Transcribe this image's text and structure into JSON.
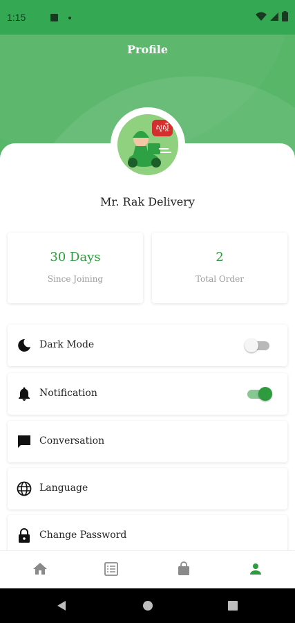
{
  "status_bar": {
    "time": "1:15"
  },
  "header": {
    "title": "Profile"
  },
  "profile": {
    "name": "Mr. Rak Delivery",
    "avatar_badge": "សូស្តី"
  },
  "stats": [
    {
      "value": "30 Days",
      "label": "Since Joining"
    },
    {
      "value": "2",
      "label": "Total Order"
    }
  ],
  "settings": [
    {
      "label": "Dark Mode",
      "icon": "moon-icon",
      "toggle": false
    },
    {
      "label": "Notification",
      "icon": "bell-icon",
      "toggle": true
    },
    {
      "label": "Conversation",
      "icon": "chat-icon"
    },
    {
      "label": "Language",
      "icon": "globe-icon"
    },
    {
      "label": "Change Password",
      "icon": "lock-icon"
    }
  ],
  "bottom_nav": [
    {
      "icon": "home-icon",
      "active": false
    },
    {
      "icon": "list-icon",
      "active": false
    },
    {
      "icon": "shopping-bag-icon",
      "active": false
    },
    {
      "icon": "person-icon",
      "active": true
    }
  ],
  "colors": {
    "primary": "#34a853",
    "header": "#57b668",
    "accent_text": "#2e9b3e",
    "inactive_icon": "#8a8a8a"
  }
}
